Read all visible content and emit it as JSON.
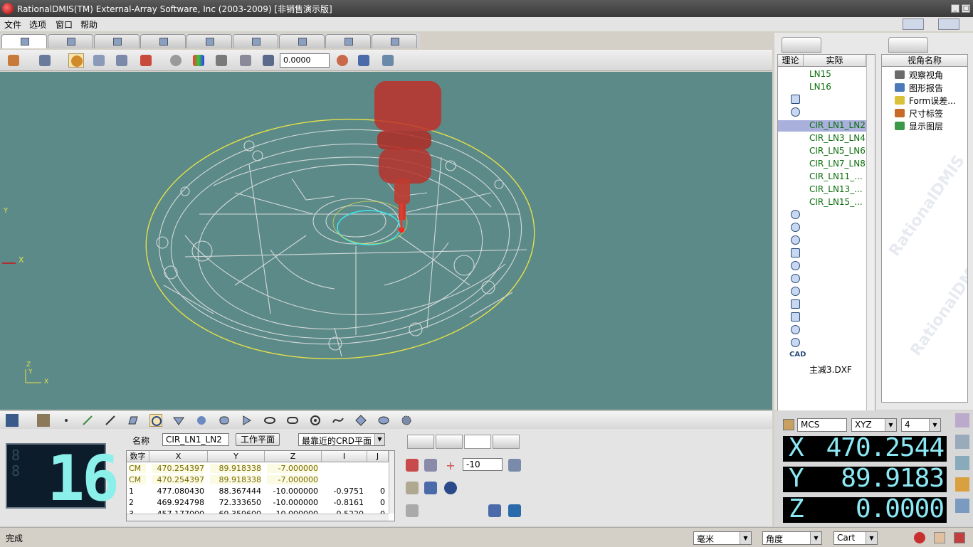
{
  "window": {
    "title": "RationalDMIS(TM) External-Array Software, Inc (2003-2009) [非销售演示版]"
  },
  "menu": [
    "文件",
    "选项",
    "窗口",
    "帮助"
  ],
  "toolbar": {
    "value": "0.0000"
  },
  "viewport": {
    "axis_y": "Y",
    "axis_x": "X",
    "triad_z": "Z",
    "triad_y": "Y",
    "triad_x": "X"
  },
  "tree": {
    "headers": [
      "理论",
      "实际"
    ],
    "items": [
      "LN15",
      "LN16",
      "CIR_LN1_LN2",
      "CIR_LN3_LN4",
      "CIR_LN5_LN6",
      "CIR_LN7_LN8",
      "CIR_LN11_...",
      "CIR_LN13_...",
      "CIR_LN15_..."
    ],
    "cad_label": "CAD",
    "cad_file": "主减3.DXF"
  },
  "views": {
    "header": "视角名称",
    "items": [
      {
        "label": "观察视角",
        "color": "#6b6b6b"
      },
      {
        "label": "图形报告",
        "color": "#4a78b8"
      },
      {
        "label": "Form误差...",
        "color": "#d9c23a"
      },
      {
        "label": "尺寸标签",
        "color": "#c86a28"
      },
      {
        "label": "显示图层",
        "color": "#3a9a4a"
      }
    ]
  },
  "feature": {
    "count": "16",
    "name_label": "名称",
    "name_value": "CIR_LN1_LN2",
    "workplane_button": "工作平面",
    "crd_select": "最靠近的CRD平面",
    "columns": [
      "数字",
      "X",
      "Y",
      "Z",
      "I",
      "J"
    ],
    "rows": [
      {
        "n": "CM",
        "x": "470.254397",
        "y": "89.918338",
        "z": "-7.000000",
        "i": "",
        "j": ""
      },
      {
        "n": "CM",
        "x": "470.254397",
        "y": "89.918338",
        "z": "-7.000000",
        "i": "",
        "j": ""
      },
      {
        "n": "1",
        "x": "477.080430",
        "y": "88.367444",
        "z": "-10.000000",
        "i": "-0.9751",
        "j": "0"
      },
      {
        "n": "2",
        "x": "469.924798",
        "y": "72.333650",
        "z": "-10.000000",
        "i": "-0.8161",
        "j": "0"
      },
      {
        "n": "3",
        "x": "457.177000",
        "y": "69.359600",
        "z": "-10.000000",
        "i": "-0.5220",
        "j": "0"
      }
    ],
    "depth_value": "-10"
  },
  "coords": {
    "system": "MCS",
    "mode": "XYZ",
    "digits": "4",
    "x_label": "X",
    "x_value": "470.2544",
    "y_label": "Y",
    "y_value": "89.9183",
    "z_label": "Z",
    "z_value": "0.0000"
  },
  "status": {
    "text": "完成",
    "units": "毫米",
    "angle": "角度",
    "coord_type": "Cart"
  },
  "colors": {
    "viewport": "#5b8a88",
    "dro_text": "#8ce8f4",
    "tree_text": "#0a6f0a"
  }
}
